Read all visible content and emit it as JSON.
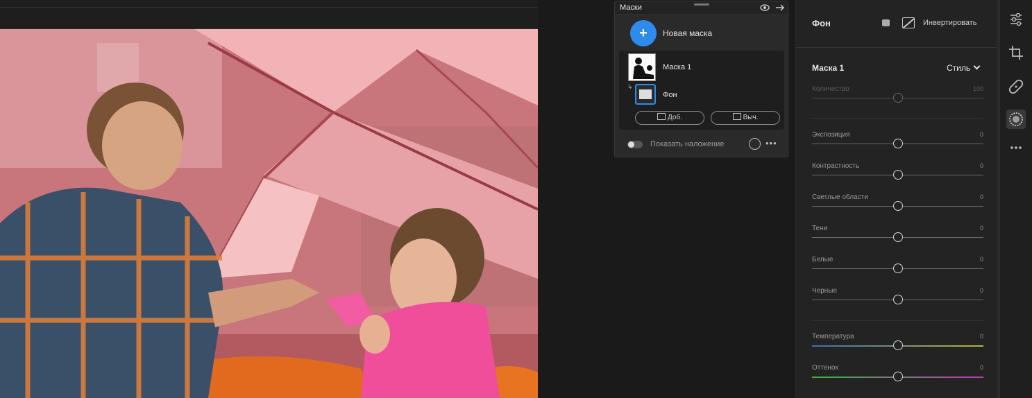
{
  "masks_panel": {
    "title": "Маски",
    "new_mask_label": "Новая маска",
    "mask_name": "Маска 1",
    "submask_name": "Фон",
    "add_label": "Доб.",
    "subtract_label": "Выч.",
    "show_overlay_label": "Показать наложение",
    "overlay_color": "#f4a0a4"
  },
  "properties": {
    "title": "Фон",
    "invert_label": "Инвертировать",
    "section_title": "Маска 1",
    "style_label": "Стиль",
    "sliders": [
      {
        "label": "Количество",
        "value": "100"
      },
      {
        "label": "Экспозиция",
        "value": "0"
      },
      {
        "label": "Контрастность",
        "value": "0"
      },
      {
        "label": "Светлые области",
        "value": "0"
      },
      {
        "label": "Тени",
        "value": "0"
      },
      {
        "label": "Белые",
        "value": "0"
      },
      {
        "label": "Черные",
        "value": "0"
      },
      {
        "label": "Температура",
        "value": "0"
      },
      {
        "label": "Оттенок",
        "value": "0"
      }
    ]
  },
  "toolbar": {
    "icons": [
      "sliders-icon",
      "crop-icon",
      "healing-icon",
      "masking-icon",
      "more-icon"
    ],
    "active": "masking-icon"
  }
}
